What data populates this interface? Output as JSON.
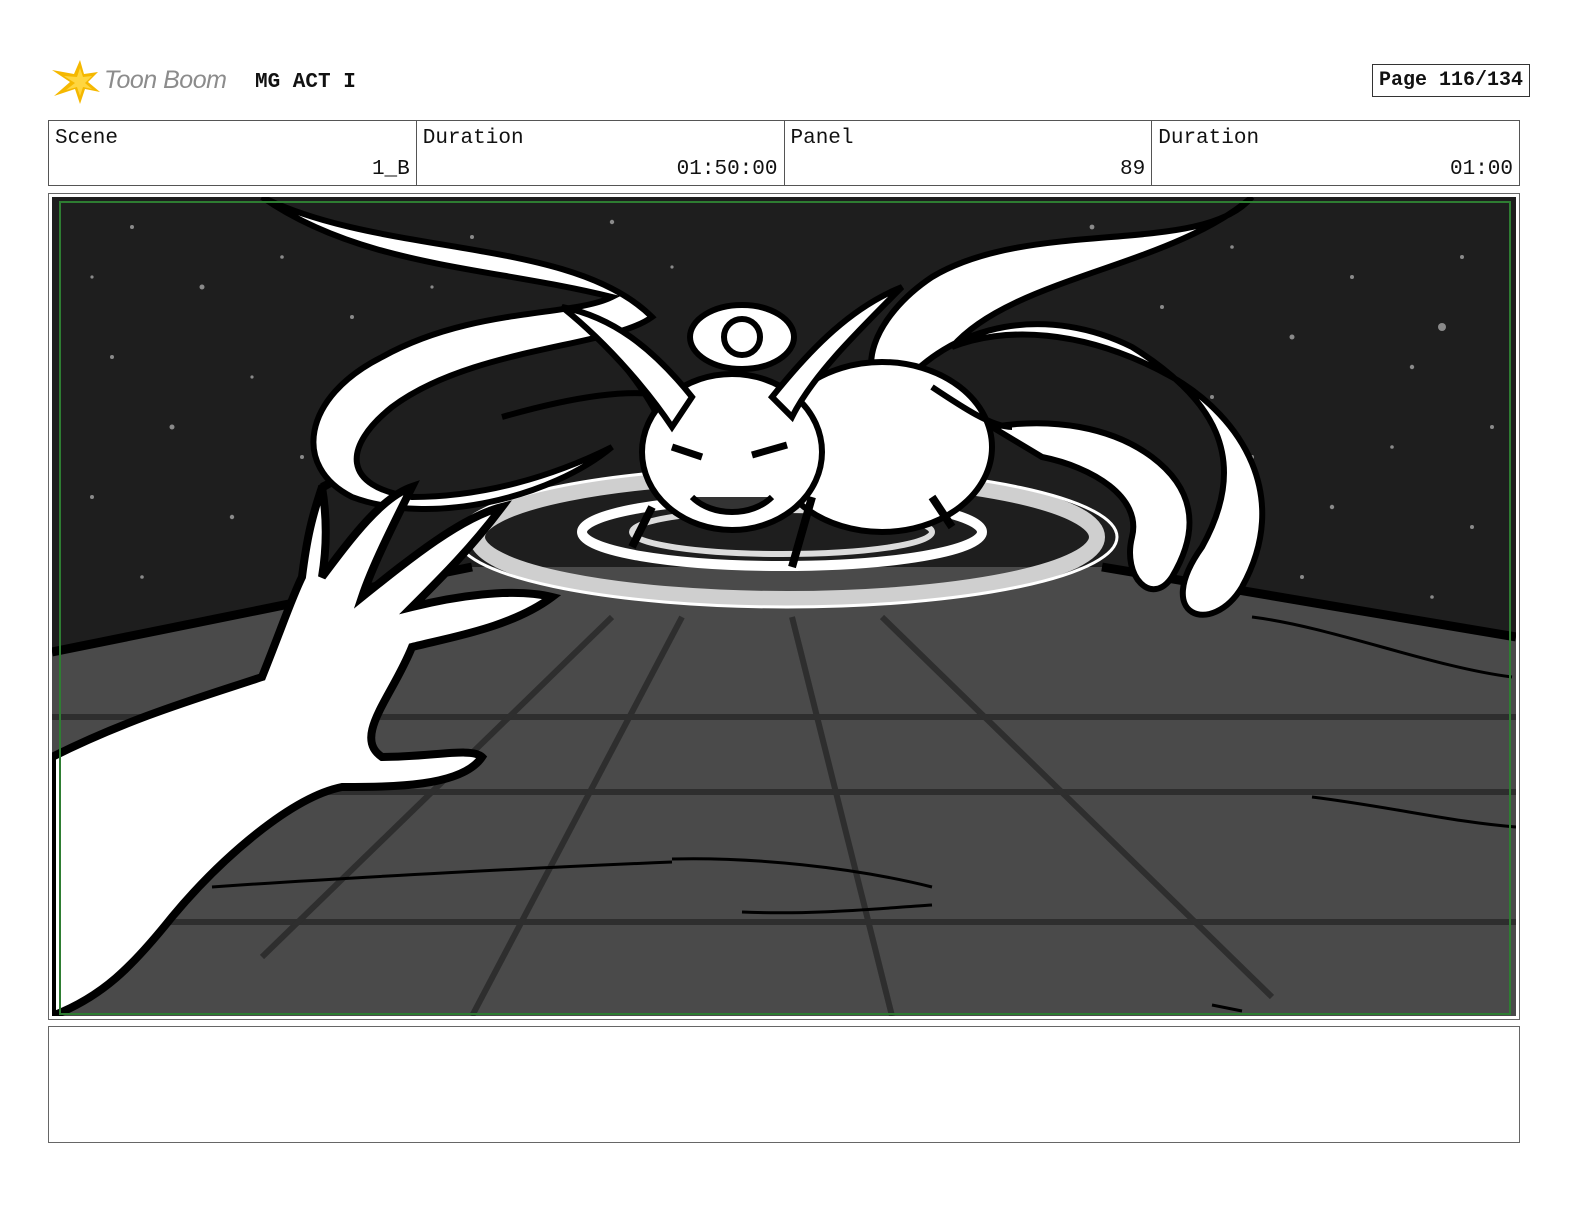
{
  "header": {
    "logo_text": "Toon Boom",
    "logo_icon": "toon-boom-star-icon",
    "project_title": "MG ACT I",
    "page_label": "Page 116/134"
  },
  "info": {
    "scene_label": "Scene",
    "scene_value": "1_B",
    "scene_duration_label": "Duration",
    "scene_duration_value": "01:50:00",
    "panel_label": "Panel",
    "panel_value": "89",
    "panel_duration_label": "Duration",
    "panel_duration_value": "01:00"
  },
  "panel": {
    "safe_frame_color": "#2e7d32",
    "sky_color": "#1e1e1e",
    "floor_color": "#4a4a4a"
  },
  "notes": {
    "text": ""
  }
}
